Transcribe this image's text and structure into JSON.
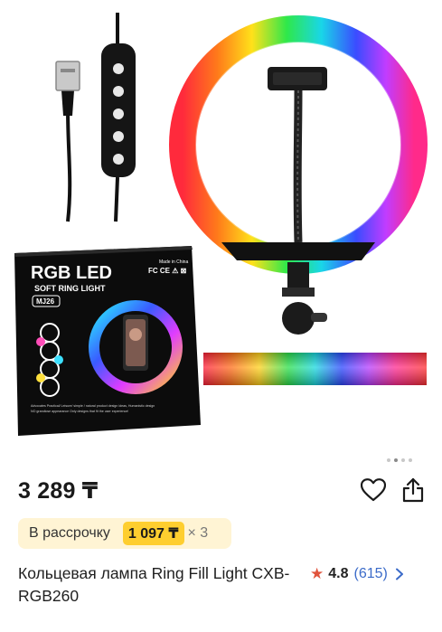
{
  "gallery": {
    "box": {
      "brand": "RGB LED",
      "subtitle": "SOFT RING LIGHT",
      "model": "MJ26",
      "made_in": "Made in China",
      "marks": "FC CE ⚠ ⊠",
      "tagline_1": "Advocates Practical/ Leisure/ simple / natural product design ideas, Humanistic design",
      "tagline_2": "NO grandiose appearance Only designs that fit the user experience!"
    },
    "slide_count": 4,
    "active_slide": 2
  },
  "product": {
    "price": "3 289 ₸",
    "installment": {
      "label": "В рассрочку",
      "amount": "1 097 ₸",
      "multiplier": "× 3"
    },
    "title": "Кольцевая лампа Ring Fill Light CXB-RGB260",
    "rating": "4.8",
    "reviews": "(615)"
  },
  "colors": {
    "installment_bg": "#fff4d4",
    "installment_amount_bg": "#fece2f",
    "star": "#e0533c",
    "link": "#3b6bc9"
  },
  "icons": [
    "heart-icon",
    "share-icon",
    "star-icon",
    "chevron-right-icon"
  ]
}
